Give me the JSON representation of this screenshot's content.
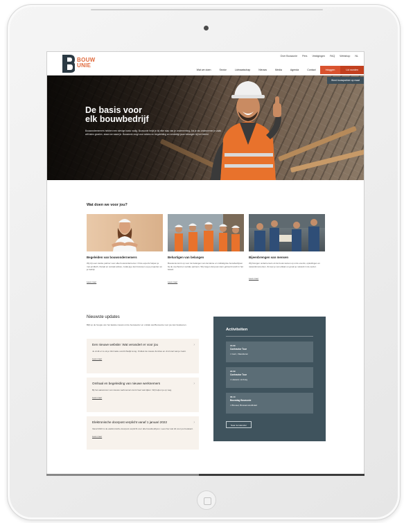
{
  "header": {
    "logo_text_1": "BOUW",
    "logo_text_2": "UNIE",
    "top_links": [
      "Over Bouwunie",
      "Pers",
      "Vestigingen",
      "FAQ",
      "Webshop",
      "NL"
    ],
    "main_nav": [
      "Wat we doen",
      "Sector",
      "Lidmaatschap",
      "Nieuws",
      "Media",
      "Agenda",
      "Contact"
    ],
    "login_label": "Inloggen",
    "member_label": "Lid worden"
  },
  "hero": {
    "title_line1": "De basis voor",
    "title_line2": "elk bouwbedrijf",
    "text": "Bouwondernemers hebben een stevige basis nodig. Bouwunie helpt je bij elke stap van je onderneming. Als je als ondernemer je zaak wilt laten groeien, staan we naast je. Bouwunie zorgt voor advies en begeleiding en verdedigt jouw belangen bij het beleid.",
    "tag": "Word bouwpartner op maat"
  },
  "services": {
    "title": "Wat doen we voor jou?",
    "cards": [
      {
        "title": "Begeleiden van bouwondernemers",
        "desc": "Wij zijn een sterke partner voor elke bouwondernemer. Onze experts helpen je met juridisch, fiscaal en sociaal advies, zodat jij je kan focussen op je projecten en je bedrijf.",
        "more": "Lees meer"
      },
      {
        "title": "Behartigen van belangen",
        "desc": "Bouwunie komt op voor de belangen van de kleine en middelgrote bouwbedrijven bij de overheid en sociale partners. Wij zorgen dat jouw stem gehoord wordt in het beleid.",
        "more": "Lees meer"
      },
      {
        "title": "Bijeenbrengen van mensen",
        "desc": "Wij brengen ondernemers uit de bouw samen op onze events, opleidingen en netwerkmomenten. Zo leer je van elkaar en groeit je netwerk in de sector.",
        "more": "Lees meer"
      }
    ]
  },
  "updates": {
    "title": "Nieuwste updates",
    "intro": "Blijf op de hoogte van het laatste nieuws uit de bouwsector en ontdek wat Bouwunie voor jou kan betekenen.",
    "items": [
      {
        "title": "Een nieuwe website: Wat verandert er voor jou",
        "desc": "Je vindt er nu al je informatie overzichtelijk terug. Ontdek de nieuwe functies en vind snel wat je zoekt.",
        "more": "Lees meer"
      },
      {
        "title": "Omhaal en begeleiding van nieuwe werknemers",
        "desc": "Bij het aanwerven van nieuwe werknemers komt heel wat kijken. Wij helpen je op weg.",
        "more": "Lees meer"
      },
      {
        "title": "Elektronische doorpost verplicht vanaf 1 januari 2022",
        "desc": "Vanaf 2022 is de elektronische doorpost verplicht voor alle bouwbedrijven. Lees hier wat dit voor jou betekent.",
        "more": "Lees meer"
      }
    ]
  },
  "activities": {
    "title": "Activiteiten",
    "items": [
      {
        "date": "15.09",
        "name": "Contractor Tour",
        "location": "Gent, Vlaanderen"
      },
      {
        "date": "22.09",
        "name": "Contractor Tour",
        "location": "Hasselt, Limburg"
      },
      {
        "date": "06.10",
        "name": "Bouwdag Bouwunie",
        "location": "Brussel, Brussel-Hoofdstad"
      }
    ],
    "button_label": "Naar de kalender"
  },
  "colors": {
    "accent": "#d9532f",
    "dark_panel": "#3f535d",
    "card_bg": "#f7f2ec"
  }
}
